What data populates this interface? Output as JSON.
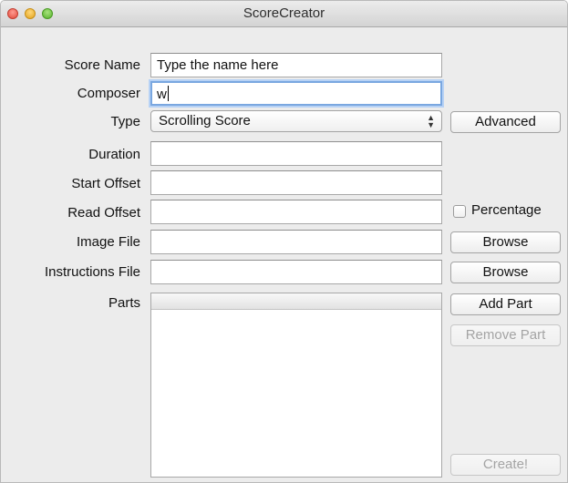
{
  "window": {
    "title": "ScoreCreator"
  },
  "form": {
    "score_name": {
      "label": "Score Name",
      "value": "Type the name here"
    },
    "composer": {
      "label": "Composer",
      "value": "w"
    },
    "type": {
      "label": "Type",
      "selected": "Scrolling Score",
      "arrows_icon": "updown-chevron-icon"
    },
    "duration": {
      "label": "Duration",
      "value": ""
    },
    "start_offset": {
      "label": "Start Offset",
      "value": ""
    },
    "read_offset": {
      "label": "Read Offset",
      "value": ""
    },
    "image_file": {
      "label": "Image File",
      "value": ""
    },
    "instructions_file": {
      "label": "Instructions File",
      "value": ""
    },
    "parts": {
      "label": "Parts",
      "items": []
    }
  },
  "buttons": {
    "advanced": "Advanced",
    "browse_image": "Browse",
    "browse_instructions": "Browse",
    "add_part": "Add Part",
    "remove_part": "Remove Part",
    "create": "Create!"
  },
  "percentage": {
    "label": "Percentage",
    "checked": false
  },
  "colors": {
    "focus_ring": "#7aa7e0",
    "window_bg": "#ececec",
    "disabled_text": "#a4a4a4"
  }
}
